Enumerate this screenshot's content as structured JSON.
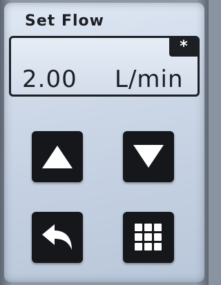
{
  "header": {
    "title": "Set Flow"
  },
  "flow": {
    "value": "2.00",
    "unit": "L/min",
    "indicator": "*"
  },
  "buttons": {
    "up": {
      "icon": "triangle-up-icon"
    },
    "down": {
      "icon": "triangle-down-icon"
    },
    "back": {
      "icon": "undo-arrow-icon"
    },
    "menu": {
      "icon": "grid-menu-icon"
    }
  },
  "colors": {
    "screen_background": "#cbd6e6",
    "button_fill": "#15171b",
    "icon_fill": "#ffffff",
    "text": "#1c1f24"
  }
}
